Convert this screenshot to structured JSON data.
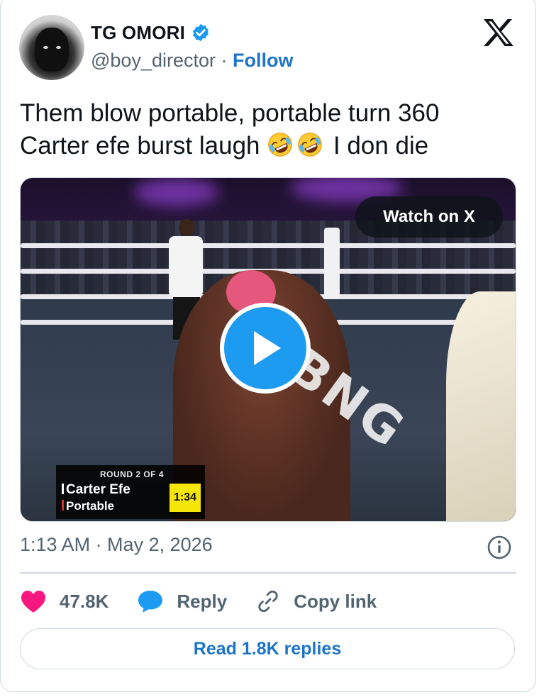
{
  "author": {
    "name": "TG OMORI",
    "handle": "@boy_director",
    "separator": "·",
    "follow_label": "Follow"
  },
  "icons": {
    "verified": "verified-badge-icon",
    "logo": "x-logo-icon",
    "play": "play-icon",
    "info": "info-icon",
    "like": "heart-icon",
    "reply": "speech-bubble-icon",
    "copy": "link-icon",
    "emoji": "rolling-on-floor-laughing-emoji"
  },
  "tweet": {
    "line1": "Them blow portable, portable turn 360",
    "line2_start": "Carter efe burst laugh ",
    "line2_end": " I don die"
  },
  "video": {
    "watch_label": "Watch on X",
    "scoreboard": {
      "round": "ROUND 2 OF 4",
      "fighter1": "Carter Efe",
      "fighter2": "Portable",
      "time": "1:34"
    }
  },
  "meta": {
    "timestamp": "1:13 AM · May 2, 2026"
  },
  "actions": {
    "likes": "47.8K",
    "reply_label": "Reply",
    "copy_label": "Copy link"
  },
  "read_replies_label": "Read 1.8K replies",
  "colors": {
    "accent": "#1d9bf0",
    "link": "#1d74c8",
    "like": "#f91880",
    "secondary_text": "#536471",
    "border": "#cfd9de"
  }
}
